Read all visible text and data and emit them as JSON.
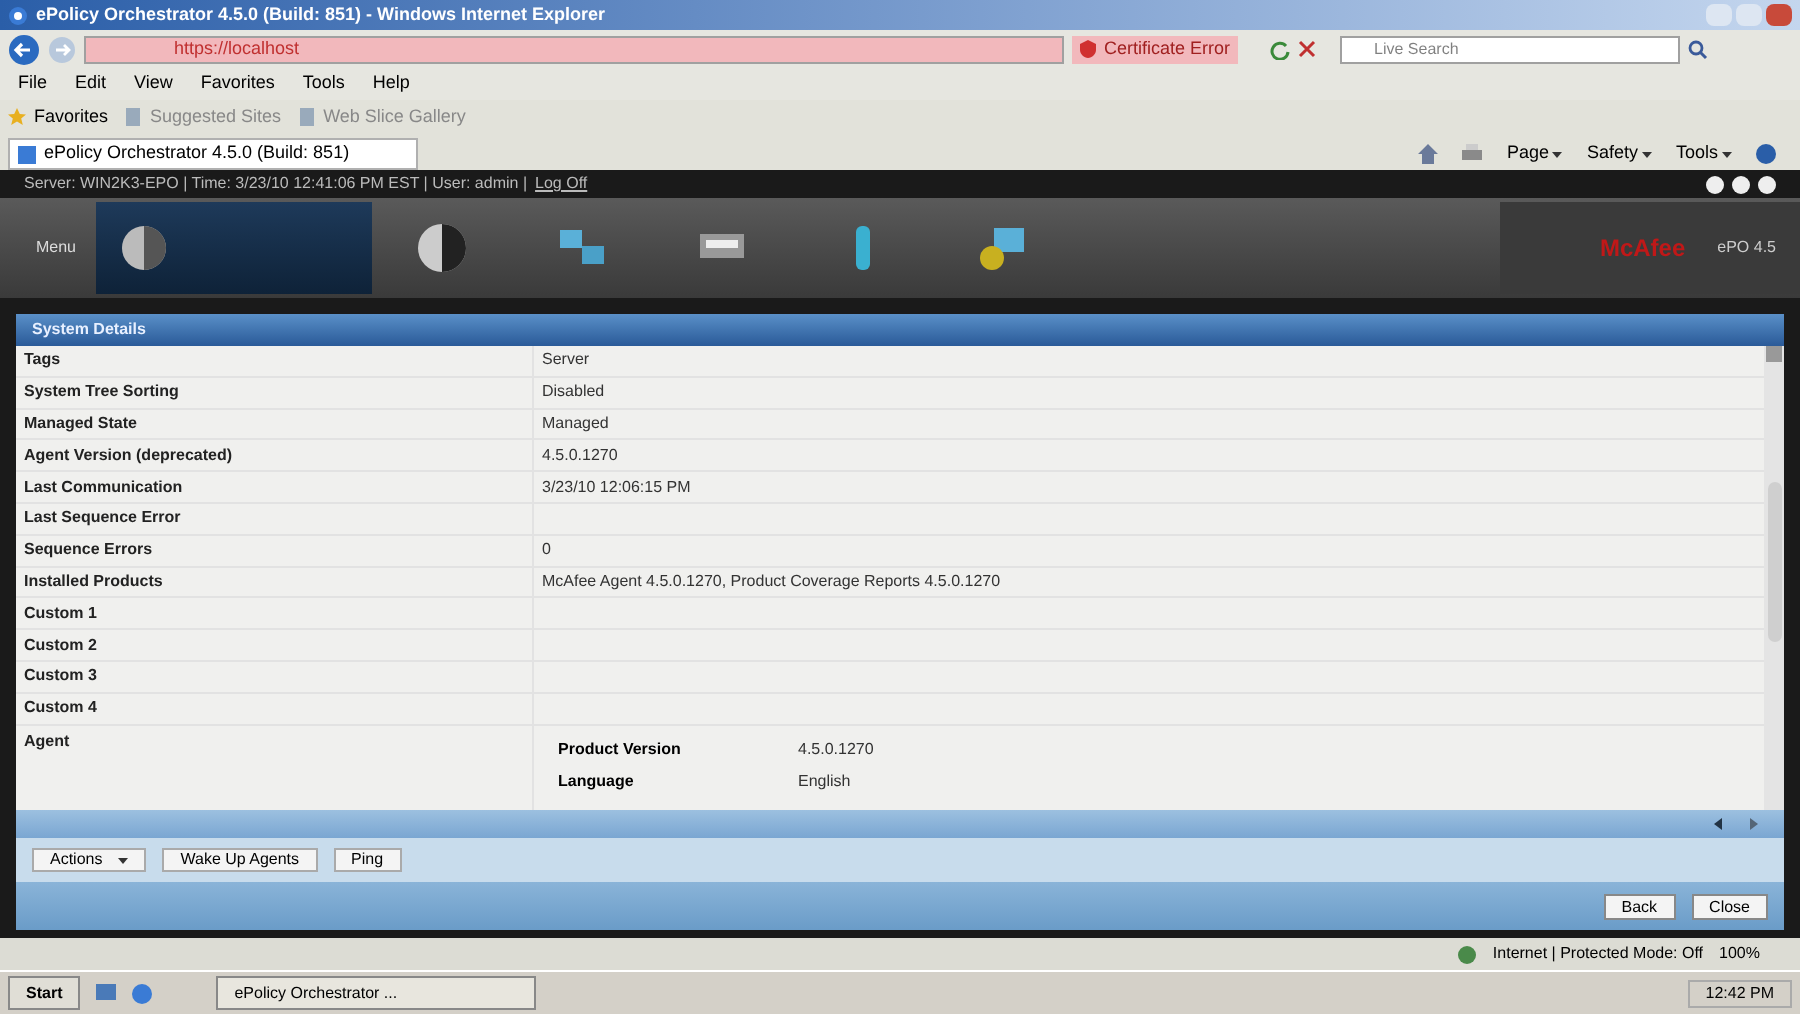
{
  "window": {
    "title": "ePolicy Orchestrator 4.5.0 (Build: 851) - Windows Internet Explorer"
  },
  "address_bar": {
    "value": "https://localhost",
    "certificate": "Certificate Error",
    "search_placeholder": "Live Search"
  },
  "menu": [
    "File",
    "Edit",
    "View",
    "Favorites",
    "Tools",
    "Help"
  ],
  "favorites_bar": [
    "Favorites",
    "Suggested Sites",
    "Web Slice Gallery"
  ],
  "browser_tab": {
    "label": "ePolicy Orchestrator 4.5.0 (Build: 851)"
  },
  "command_bar": [
    "Page",
    "Safety",
    "Tools"
  ],
  "session_bar": {
    "text": "Server: WIN2K3-EPO | Time: 3/23/10 12:41:06 PM EST | User: admin |",
    "logoff": "Log Off"
  },
  "nav": {
    "menu": "Menu",
    "logo": "McAfee",
    "version": "ePO 4.5"
  },
  "panel": {
    "title": "System Details"
  },
  "rows": [
    {
      "kind": "field",
      "label": "Tags",
      "value": "Server"
    },
    {
      "kind": "field",
      "label": "System Tree Sorting",
      "value": "Disabled"
    },
    {
      "kind": "field",
      "label": "Managed State",
      "value": "Managed"
    },
    {
      "kind": "field",
      "label": "Agent Version (deprecated)",
      "value": "4.5.0.1270"
    },
    {
      "kind": "field",
      "label": "Last Communication",
      "value": "3/23/10 12:06:15 PM"
    },
    {
      "kind": "field",
      "label": "Last Sequence Error"
    },
    {
      "kind": "field",
      "label": "Sequence Errors",
      "value": "0"
    },
    {
      "kind": "field",
      "label": "Installed Products",
      "value": "McAfee Agent 4.5.0.1270, Product Coverage Reports 4.5.0.1270"
    },
    {
      "kind": "field",
      "label": "Custom 1"
    },
    {
      "kind": "field",
      "label": "Custom 2"
    },
    {
      "kind": "field",
      "label": "Custom 3"
    },
    {
      "kind": "field",
      "label": "Custom 4"
    },
    {
      "kind": "group",
      "label": "Agent",
      "children": [
        {
          "label": "Product Version",
          "value": "4.5.0.1270"
        },
        {
          "label": "Language",
          "value": "English"
        }
      ]
    }
  ],
  "actions": [
    {
      "label": "Actions",
      "menu": true
    },
    {
      "label": "Wake Up Agents",
      "menu": false
    },
    {
      "label": "Ping",
      "menu": false
    }
  ],
  "footer_buttons": [
    "Back",
    "Close"
  ],
  "status_bar": {
    "zone": "Internet | Protected Mode: Off",
    "zoom": "100%"
  },
  "taskbar": {
    "start": "Start",
    "task": "ePolicy Orchestrator ...",
    "clock": "12:42 PM"
  }
}
